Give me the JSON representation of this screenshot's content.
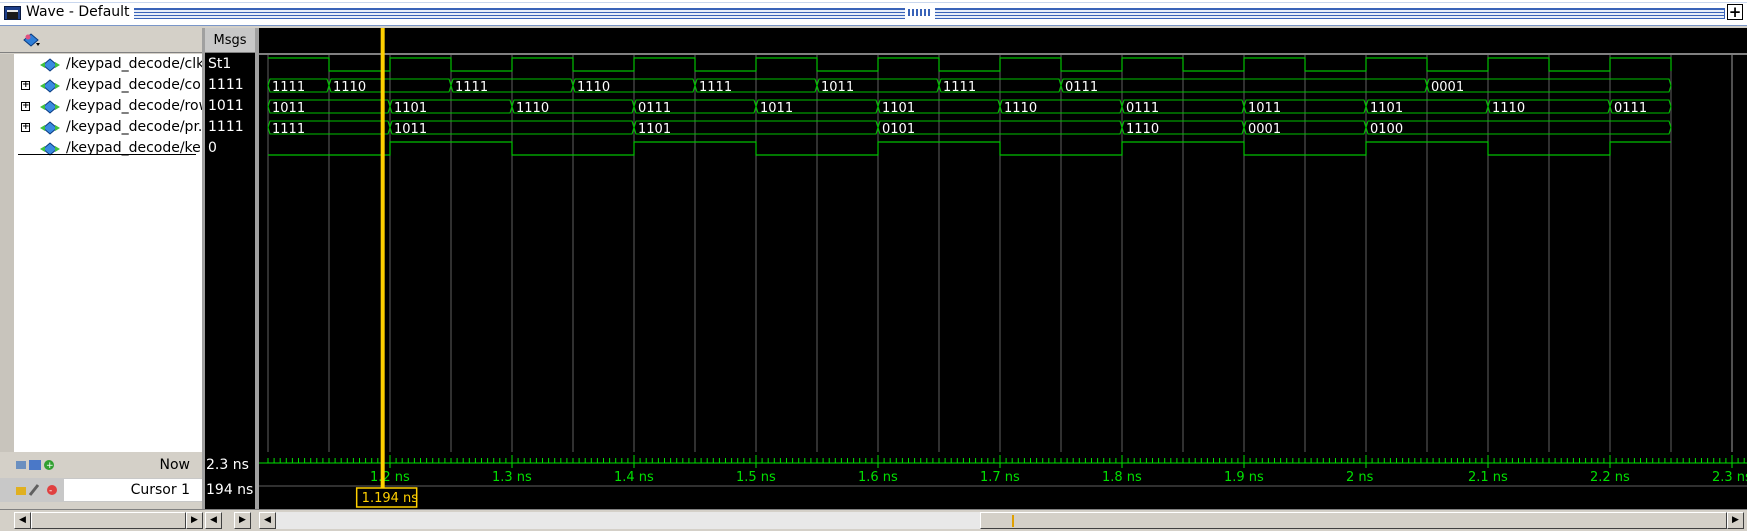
{
  "window": {
    "title": "Wave - Default"
  },
  "header": {
    "msgs_label": "Msgs"
  },
  "signals": [
    {
      "name": "/keypad_decode/clk",
      "value": "St1",
      "kind": "bit",
      "expandable": false
    },
    {
      "name": "/keypad_decode/co...",
      "value": "1111",
      "kind": "bus",
      "expandable": true
    },
    {
      "name": "/keypad_decode/row",
      "value": "1011",
      "kind": "bus",
      "expandable": true
    },
    {
      "name": "/keypad_decode/pr...",
      "value": "1111",
      "kind": "bus",
      "expandable": true
    },
    {
      "name": "/keypad_decode/ke...",
      "value": "0",
      "kind": "bit",
      "expandable": false
    }
  ],
  "waves": {
    "time_start_ns": 1.1,
    "time_end_ns": 2.3,
    "ticks": [
      "1.2 ns",
      "1.3 ns",
      "1.4 ns",
      "1.5 ns",
      "1.6 ns",
      "1.7 ns",
      "1.8 ns",
      "1.9 ns",
      "2 ns",
      "2.1 ns",
      "2.2 ns",
      "2.3 ns"
    ],
    "tick_times_ns": [
      1.2,
      1.3,
      1.4,
      1.5,
      1.6,
      1.7,
      1.8,
      1.9,
      2.0,
      2.1,
      2.2,
      2.3
    ],
    "clk_edges_ns": [
      1.1,
      1.15,
      1.2,
      1.25,
      1.3,
      1.35,
      1.4,
      1.45,
      1.5,
      1.55,
      1.6,
      1.65,
      1.7,
      1.75,
      1.8,
      1.85,
      1.9,
      1.95,
      2.0,
      2.05,
      2.1,
      2.15,
      2.2,
      2.25
    ],
    "clk_start_high": true,
    "col_bus": [
      {
        "t": 1.1,
        "v": "1111"
      },
      {
        "t": 1.15,
        "v": "1110"
      },
      {
        "t": 1.25,
        "v": "1111"
      },
      {
        "t": 1.35,
        "v": "1110"
      },
      {
        "t": 1.45,
        "v": "1111"
      },
      {
        "t": 1.55,
        "v": "1011"
      },
      {
        "t": 1.65,
        "v": "1111"
      },
      {
        "t": 1.75,
        "v": "0111"
      },
      {
        "t": 2.05,
        "v": "0001"
      }
    ],
    "row_bus": [
      {
        "t": 1.1,
        "v": "1011"
      },
      {
        "t": 1.2,
        "v": "1101"
      },
      {
        "t": 1.3,
        "v": "1110"
      },
      {
        "t": 1.4,
        "v": "0111"
      },
      {
        "t": 1.5,
        "v": "1011"
      },
      {
        "t": 1.6,
        "v": "1101"
      },
      {
        "t": 1.7,
        "v": "1110"
      },
      {
        "t": 1.8,
        "v": "0111"
      },
      {
        "t": 1.9,
        "v": "1011"
      },
      {
        "t": 2.0,
        "v": "1101"
      },
      {
        "t": 2.1,
        "v": "1110"
      },
      {
        "t": 2.2,
        "v": "0111"
      }
    ],
    "pr_bus": [
      {
        "t": 1.1,
        "v": "1111"
      },
      {
        "t": 1.2,
        "v": "1011"
      },
      {
        "t": 1.4,
        "v": "1101"
      },
      {
        "t": 1.6,
        "v": "0101"
      },
      {
        "t": 1.8,
        "v": "1110"
      },
      {
        "t": 1.9,
        "v": "0001"
      },
      {
        "t": 2.0,
        "v": "0100"
      }
    ],
    "ke_edges_ns": [
      1.1,
      1.2,
      1.3,
      1.4,
      1.5,
      1.6,
      1.7,
      1.8,
      1.9,
      2.0,
      2.1,
      2.2
    ],
    "ke_start_high": false,
    "signal_end_ns": 2.25
  },
  "status": {
    "now_label": "Now",
    "now_value": "2.3 ns",
    "cursor_label": "Cursor 1",
    "cursor_value": "194 ns",
    "cursor_time_label": "1.194 ns",
    "cursor_time_ns": 1.194
  },
  "colors": {
    "wave": "#00c000",
    "cursor": "#ffd000",
    "ticks": "#00e000",
    "grid": "#a0a0a0"
  }
}
